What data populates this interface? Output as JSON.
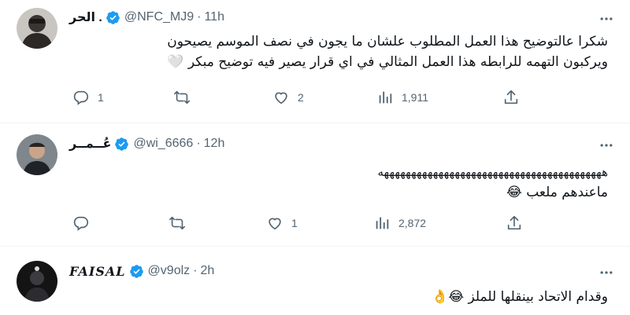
{
  "tweets": [
    {
      "name": "الحر .",
      "handle": "@NFC_MJ9",
      "separator": "·",
      "time": "11h",
      "lines": [
        "شكرا عالتوضيح هذا العمل المطلوب علشان ما يجون في نصف الموسم يصيحون",
        "ويركبون التهمه للرابطه هذا العمل المثالي في اي قرار يصير فيه توضيح مبكر 🤍"
      ],
      "replies": "1",
      "retweets": "",
      "likes": "2",
      "views": "1,911"
    },
    {
      "name": "عُــمــر",
      "handle": "@wi_6666",
      "separator": "·",
      "time": "12h",
      "lines": [
        "هههههههههههههههههههههههههههههههههههههههههه",
        "ماعندهم ملعب 😂"
      ],
      "replies": "",
      "retweets": "",
      "likes": "1",
      "views": "2,872"
    },
    {
      "name": "FAISAL",
      "handle": "@v9olz",
      "separator": "·",
      "time": "2h",
      "lines": [
        "وقدام الاتحاد بينقلها للملز 😂👌"
      ]
    }
  ],
  "icons": {
    "verified": "verified-badge-icon",
    "more": "more-icon",
    "reply": "reply-icon",
    "retweet": "retweet-icon",
    "like": "like-icon",
    "views": "views-icon",
    "share": "share-icon"
  },
  "colors": {
    "verified": "#1d9bf0",
    "secondary_text": "#536471",
    "divider": "#eff3f4"
  }
}
